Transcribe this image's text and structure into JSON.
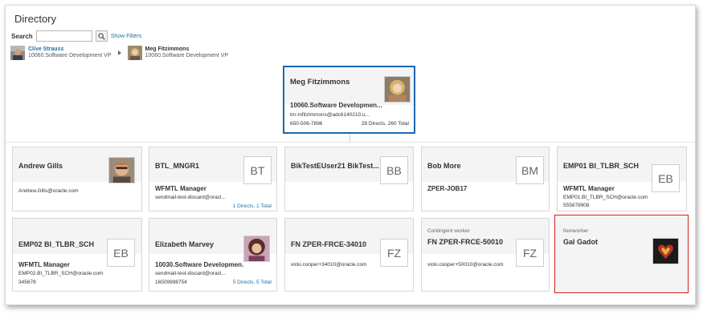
{
  "header": {
    "title": "Directory"
  },
  "search": {
    "label": "Search",
    "value": "",
    "filters_link": "Show Filters"
  },
  "breadcrumb": [
    {
      "name": "Clive Strauss",
      "dept": "10060.Software Development VP"
    },
    {
      "name": "Meg Fitzimmons",
      "dept": "10060.Software Development VP"
    }
  ],
  "manager": {
    "name": "Meg Fitzimmons",
    "dept": "10060.Software Developmen...",
    "email": "tm-mfitzimmons@adc6140210.u...",
    "phone": "650-506-7896",
    "reports": "28 Directs, 260 Total"
  },
  "cards": [
    {
      "name": "Andrew Gills",
      "email": "Andrew.Gills@oracle.com"
    },
    {
      "name": "BTL_MNGR1",
      "initials": "BT",
      "job": "WFMTL Manager",
      "email": "sendmail-test-discard@oracl...",
      "reports": "1 Directs, 1 Total"
    },
    {
      "name": "BikTestEUser21 BikTest...",
      "initials": "BB"
    },
    {
      "name": "Bob More",
      "initials": "BM",
      "job": "ZPER-JOB17"
    },
    {
      "name": "EMP01 BI_TLBR_SCH",
      "initials": "EB",
      "job": "WFMTL Manager",
      "email": "EMP01.BI_TLBR_SCH@oracle.com",
      "phone": "555678908"
    },
    {
      "name": "EMP02 BI_TLBR_SCH",
      "initials": "EB",
      "job": "WFMTL Manager",
      "email": "EMP02.BI_TLBR_SCH@oracle.com",
      "phone": "345678"
    },
    {
      "name": "Elizabeth Marvey",
      "job": "10030.Software Developmen...",
      "email": "sendmail-test-discard@oracl...",
      "phone": "16509998754",
      "reports": "5 Directs, 5 Total"
    },
    {
      "name": "FN ZPER-FRCE-34010",
      "initials": "FZ",
      "email": "vicki.cooper+34010@oracle.com"
    },
    {
      "type": "Contingent worker",
      "name": "FN ZPER-FRCE-50010",
      "initials": "FZ",
      "email": "vicki.cooper+50010@oracle.com"
    },
    {
      "type": "Nonworker",
      "name": "Gal Gadot"
    }
  ]
}
